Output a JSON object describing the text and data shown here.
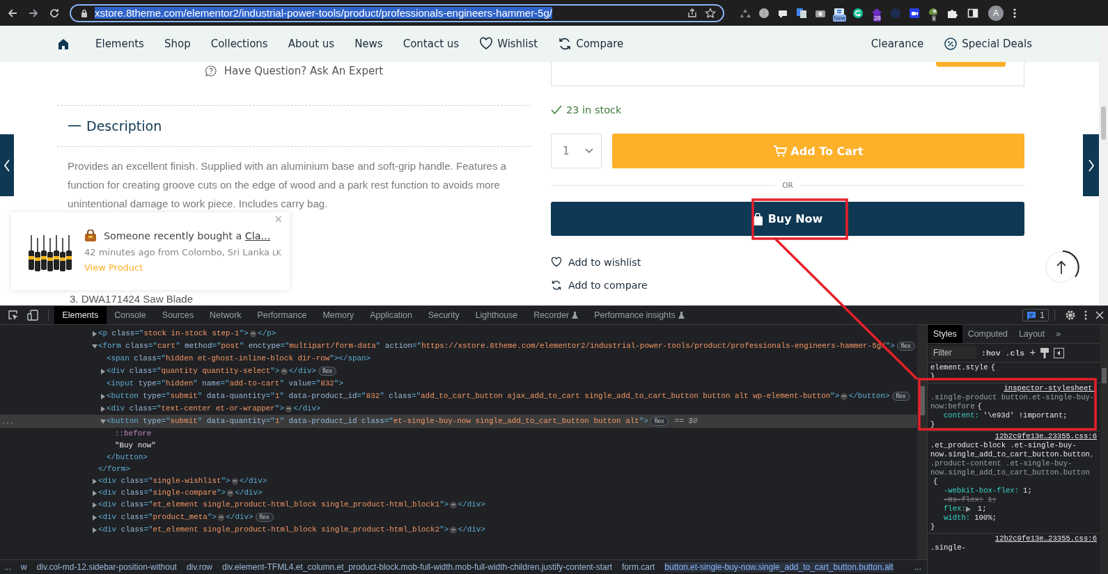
{
  "browser": {
    "url": "xstore.8theme.com/elementor2/industrial-power-tools/product/professionals-engineers-hammer-5g/",
    "url_selected": true,
    "extensions": [
      {
        "kind": "recycle"
      },
      {
        "kind": "globe"
      },
      {
        "kind": "card"
      },
      {
        "kind": "translate"
      },
      {
        "kind": "camera"
      },
      {
        "kind": "news",
        "badge": "New"
      },
      {
        "kind": "grammar"
      },
      {
        "kind": "gem",
        "badge": "28"
      },
      {
        "kind": "moon"
      },
      {
        "kind": "video"
      },
      {
        "kind": "ball",
        "badge": "x"
      },
      {
        "kind": "puzzle"
      }
    ],
    "profile": "A"
  },
  "nav": {
    "items": [
      {
        "label": "Elements",
        "kind": "plain"
      },
      {
        "label": "Shop",
        "kind": "plain"
      },
      {
        "label": "Collections",
        "kind": "plain"
      },
      {
        "label": "About us",
        "kind": "plain"
      },
      {
        "label": "News",
        "kind": "plain"
      },
      {
        "label": "Contact us",
        "kind": "plain"
      },
      {
        "label": "Wishlist",
        "kind": "wishlist"
      },
      {
        "label": "Compare",
        "kind": "compare"
      }
    ],
    "right_items": [
      {
        "label": "Clearance",
        "kind": "plain"
      },
      {
        "label": "Special Deals",
        "kind": "deals"
      }
    ]
  },
  "product": {
    "question": "Have Question? Ask An Expert",
    "description_title": "Description",
    "description": "Provides an excellent finish. Supplied with an aluminium base and soft-grip handle. Features a function for creating groove cuts on the edge of wood and a park rest function to avoids more unintentional damage to work piece. Includes carry bag.",
    "list_item": "3. DWA171424 Saw Blade",
    "stock": "23 in stock",
    "quantity": "1",
    "add_to_cart": "Add To Cart",
    "or": "OR",
    "buy_now": "Buy Now",
    "wishlist": "Add to wishlist",
    "compare": "Add to compare"
  },
  "notification": {
    "text": "Someone recently bought a ",
    "link": "Cla...",
    "meta": "42 minutes ago from Colombo, Sri Lanka",
    "country": "LK",
    "action": "View Product",
    "close": "×"
  },
  "devtools": {
    "tabs": [
      {
        "label": "Elements",
        "selected": true,
        "experimental": false
      },
      {
        "label": "Console",
        "selected": false,
        "experimental": false
      },
      {
        "label": "Sources",
        "selected": false,
        "experimental": false
      },
      {
        "label": "Network",
        "selected": false,
        "experimental": false
      },
      {
        "label": "Performance",
        "selected": false,
        "experimental": false
      },
      {
        "label": "Memory",
        "selected": false,
        "experimental": false
      },
      {
        "label": "Application",
        "selected": false,
        "experimental": false
      },
      {
        "label": "Security",
        "selected": false,
        "experimental": false
      },
      {
        "label": "Lighthouse",
        "selected": false,
        "experimental": false
      },
      {
        "label": "Recorder",
        "selected": false,
        "experimental": true
      },
      {
        "label": "Performance insights",
        "selected": false,
        "experimental": true
      }
    ],
    "issues": "1",
    "tree": [
      {
        "kind": "container",
        "expanded": false,
        "selected": false,
        "open": [
          {
            "kind": "tag",
            "text": "<p "
          },
          {
            "kind": "attr",
            "text": "class"
          },
          {
            "kind": "tag",
            "text": "=\""
          },
          {
            "kind": "val",
            "text": "stock in-stock step-1"
          },
          {
            "kind": "tag",
            "text": "\">"
          }
        ],
        "more": "⋯",
        "close": [
          {
            "kind": "tag",
            "text": "</p>"
          }
        ]
      },
      {
        "kind": "container",
        "expanded": true,
        "selected": false,
        "open": [
          {
            "kind": "tag",
            "text": "<form "
          },
          {
            "kind": "attr",
            "text": "class"
          },
          {
            "kind": "tag",
            "text": "=\""
          },
          {
            "kind": "val",
            "text": "cart"
          },
          {
            "kind": "tag",
            "text": "\" "
          },
          {
            "kind": "attr",
            "text": "method"
          },
          {
            "kind": "tag",
            "text": "=\""
          },
          {
            "kind": "val",
            "text": "post"
          },
          {
            "kind": "tag",
            "text": "\" "
          },
          {
            "kind": "attr",
            "text": "enctype"
          },
          {
            "kind": "tag",
            "text": "=\""
          },
          {
            "kind": "val",
            "text": "multipart/form-data"
          },
          {
            "kind": "tag",
            "text": "\" "
          },
          {
            "kind": "attr",
            "text": "action"
          },
          {
            "kind": "tag",
            "text": "=\""
          },
          {
            "kind": "val",
            "text": "https://xstore.8theme.com/elementor2/industrial-power-tools/product/professionals-engineers-hammer-5g/"
          },
          {
            "kind": "tag",
            "text": "\">"
          }
        ],
        "badge": "flex",
        "children": [
          {
            "kind": "leaf",
            "selected": false,
            "open": [
              {
                "kind": "tag",
                "text": "<span "
              },
              {
                "kind": "attr",
                "text": "class"
              },
              {
                "kind": "tag",
                "text": "=\""
              },
              {
                "kind": "val",
                "text": "hidden et-ghost-inline-block dir-row"
              },
              {
                "kind": "tag",
                "text": "\"></span>"
              }
            ]
          },
          {
            "kind": "container",
            "expanded": false,
            "selected": false,
            "open": [
              {
                "kind": "tag",
                "text": "<div "
              },
              {
                "kind": "attr",
                "text": "class"
              },
              {
                "kind": "tag",
                "text": "=\""
              },
              {
                "kind": "val",
                "text": "quantity quantity-select"
              },
              {
                "kind": "tag",
                "text": "\">"
              }
            ],
            "more": "⋯",
            "close": [
              {
                "kind": "tag",
                "text": "</div>"
              }
            ],
            "badge": "flex"
          },
          {
            "kind": "leaf",
            "selected": false,
            "open": [
              {
                "kind": "tag",
                "text": "<input "
              },
              {
                "kind": "attr",
                "text": "type"
              },
              {
                "kind": "tag",
                "text": "=\""
              },
              {
                "kind": "val",
                "text": "hidden"
              },
              {
                "kind": "tag",
                "text": "\" "
              },
              {
                "kind": "attr",
                "text": "name"
              },
              {
                "kind": "tag",
                "text": "=\""
              },
              {
                "kind": "val",
                "text": "add-to-cart"
              },
              {
                "kind": "tag",
                "text": "\" "
              },
              {
                "kind": "attr",
                "text": "value"
              },
              {
                "kind": "tag",
                "text": "=\""
              },
              {
                "kind": "val",
                "text": "832"
              },
              {
                "kind": "tag",
                "text": "\">"
              }
            ]
          },
          {
            "kind": "container",
            "expanded": false,
            "selected": false,
            "open": [
              {
                "kind": "tag",
                "text": "<button "
              },
              {
                "kind": "attr",
                "text": "type"
              },
              {
                "kind": "tag",
                "text": "=\""
              },
              {
                "kind": "val",
                "text": "submit"
              },
              {
                "kind": "tag",
                "text": "\" "
              },
              {
                "kind": "attr",
                "text": "data-quantity"
              },
              {
                "kind": "tag",
                "text": "=\""
              },
              {
                "kind": "val",
                "text": "1"
              },
              {
                "kind": "tag",
                "text": "\" "
              },
              {
                "kind": "attr",
                "text": "data-product_id"
              },
              {
                "kind": "tag",
                "text": "=\""
              },
              {
                "kind": "val",
                "text": "832"
              },
              {
                "kind": "tag",
                "text": "\" "
              },
              {
                "kind": "attr",
                "text": "class"
              },
              {
                "kind": "tag",
                "text": "=\""
              },
              {
                "kind": "val",
                "text": "add_to_cart_button ajax_add_to_cart single_add_to_cart_button button alt wp-element-button"
              },
              {
                "kind": "tag",
                "text": "\">"
              }
            ],
            "more": "⋯",
            "close": [
              {
                "kind": "tag",
                "text": "</button>"
              }
            ],
            "badge": "flex"
          },
          {
            "kind": "container",
            "expanded": false,
            "selected": false,
            "open": [
              {
                "kind": "tag",
                "text": "<div "
              },
              {
                "kind": "attr",
                "text": "class"
              },
              {
                "kind": "tag",
                "text": "=\""
              },
              {
                "kind": "val",
                "text": "text-center et-or-wrapper"
              },
              {
                "kind": "tag",
                "text": "\">"
              }
            ],
            "more": "⋯",
            "close": [
              {
                "kind": "tag",
                "text": "</div>"
              }
            ]
          },
          {
            "kind": "container",
            "expanded": true,
            "selected": true,
            "gutter": "...",
            "open": [
              {
                "kind": "tag",
                "text": "<button "
              },
              {
                "kind": "attr",
                "text": "type"
              },
              {
                "kind": "tag",
                "text": "=\""
              },
              {
                "kind": "val",
                "text": "submit"
              },
              {
                "kind": "tag",
                "text": "\" "
              },
              {
                "kind": "attr",
                "text": "data-quantity"
              },
              {
                "kind": "tag",
                "text": "=\""
              },
              {
                "kind": "val",
                "text": "1"
              },
              {
                "kind": "tag",
                "text": "\" "
              },
              {
                "kind": "attr",
                "text": "data-product_id class"
              },
              {
                "kind": "tag",
                "text": "=\""
              },
              {
                "kind": "val",
                "text": "et-single-buy-now single_add_to_cart_button button alt"
              },
              {
                "kind": "tag",
                "text": "\">"
              }
            ],
            "badge": "flex",
            "reference": "== $0",
            "children": [
              {
                "kind": "pseudo",
                "selected": false,
                "text": "::before"
              },
              {
                "kind": "text",
                "selected": false,
                "text": "\"Buy now\""
              }
            ],
            "close": [
              {
                "kind": "tag",
                "text": "</button>"
              }
            ]
          }
        ],
        "close": [
          {
            "kind": "tag",
            "text": "</form>"
          }
        ]
      },
      {
        "kind": "container",
        "expanded": false,
        "selected": false,
        "open": [
          {
            "kind": "tag",
            "text": "<div "
          },
          {
            "kind": "attr",
            "text": "class"
          },
          {
            "kind": "tag",
            "text": "=\""
          },
          {
            "kind": "val",
            "text": "single-wishlist"
          },
          {
            "kind": "tag",
            "text": "\">"
          }
        ],
        "more": "⋯",
        "close": [
          {
            "kind": "tag",
            "text": "</div>"
          }
        ]
      },
      {
        "kind": "container",
        "expanded": false,
        "selected": false,
        "open": [
          {
            "kind": "tag",
            "text": "<div "
          },
          {
            "kind": "attr",
            "text": "class"
          },
          {
            "kind": "tag",
            "text": "=\""
          },
          {
            "kind": "val",
            "text": "single-compare"
          },
          {
            "kind": "tag",
            "text": "\">"
          }
        ],
        "more": "⋯",
        "close": [
          {
            "kind": "tag",
            "text": "</div>"
          }
        ]
      },
      {
        "kind": "container",
        "expanded": false,
        "selected": false,
        "open": [
          {
            "kind": "tag",
            "text": "<div "
          },
          {
            "kind": "attr",
            "text": "class"
          },
          {
            "kind": "tag",
            "text": "=\""
          },
          {
            "kind": "val",
            "text": "et_element single_product-html_block single_product-html_block1"
          },
          {
            "kind": "tag",
            "text": "\">"
          }
        ],
        "more": "⋯",
        "close": [
          {
            "kind": "tag",
            "text": "</div>"
          }
        ]
      },
      {
        "kind": "container",
        "expanded": false,
        "selected": false,
        "open": [
          {
            "kind": "tag",
            "text": "<div "
          },
          {
            "kind": "attr",
            "text": "class"
          },
          {
            "kind": "tag",
            "text": "=\""
          },
          {
            "kind": "val",
            "text": "product_meta"
          },
          {
            "kind": "tag",
            "text": "\">"
          }
        ],
        "more": "⋯",
        "close": [
          {
            "kind": "tag",
            "text": "</div>"
          }
        ],
        "badge": "flex"
      },
      {
        "kind": "container",
        "expanded": false,
        "selected": false,
        "open": [
          {
            "kind": "tag",
            "text": "<div "
          },
          {
            "kind": "attr",
            "text": "class"
          },
          {
            "kind": "tag",
            "text": "=\""
          },
          {
            "kind": "val",
            "text": "et_element single_product-html_block single_product-html_block2"
          },
          {
            "kind": "tag",
            "text": "\">"
          }
        ],
        "more": "⋯",
        "close": [
          {
            "kind": "tag",
            "text": "</div>"
          }
        ]
      }
    ],
    "breadcrumbs": [
      {
        "label": "...",
        "selected": false
      },
      {
        "label": "w",
        "selected": false
      },
      {
        "label": "div.col-md-12.sidebar-position-without",
        "selected": false
      },
      {
        "label": "div.row",
        "selected": false
      },
      {
        "label": "div.element-TFML4.et_column.et_product-block.mob-full-width.mob-full-width-children.justify-content-start",
        "selected": false
      },
      {
        "label": "form.cart",
        "selected": false
      },
      {
        "label": "button.et-single-buy-now.single_add_to_cart_button.button.alt",
        "selected": true
      },
      {
        "label": "...",
        "selected": false
      }
    ],
    "side_tabs": [
      {
        "label": "Styles",
        "selected": true
      },
      {
        "label": "Computed",
        "selected": false
      },
      {
        "label": "Layout",
        "selected": false
      }
    ],
    "more_tabs": "»",
    "filter_placeholder": "Filter",
    "hov": ":hov",
    "cls": ".cls",
    "add": "+",
    "rules": [
      {
        "selector": [
          {
            "matched": true,
            "text": "element.style"
          }
        ],
        "open": "{",
        "close": "}"
      },
      {
        "selector": [
          {
            "matched": false,
            "text": ".single-product button.et-single-buy-now:before"
          }
        ],
        "source": "inspector-stylesheet:",
        "open": "{",
        "props": [
          {
            "name": "content:",
            "value": "'\\e93d' !important;",
            "struck": false,
            "expandable": false
          }
        ],
        "close": "}"
      },
      {
        "selector": [
          {
            "matched": true,
            "text": ".et_product-block .et-single-buy-now.single_add_to_cart_button.button"
          },
          {
            "matched": false,
            "text": ", .product-content .et-single-buy-now.single_add_to_cart_button.button"
          }
        ],
        "source": "12b2c9fe13e…23355.css:6",
        "open": "{",
        "props": [
          {
            "name": "-webkit-box-flex:",
            "value": "1;",
            "struck": false,
            "expandable": false
          },
          {
            "name": "-ms-flex:",
            "value": "1;",
            "struck": true,
            "expandable": false
          },
          {
            "name": "flex:",
            "value": "1;",
            "struck": false,
            "expandable": true
          },
          {
            "name": "width:",
            "value": "100%;",
            "struck": false,
            "expandable": false
          }
        ],
        "close": "}"
      },
      {
        "selector": [
          {
            "matched": true,
            "text": ".single-"
          }
        ],
        "source": "12b2c9fe13e…23355.css:6"
      }
    ]
  }
}
